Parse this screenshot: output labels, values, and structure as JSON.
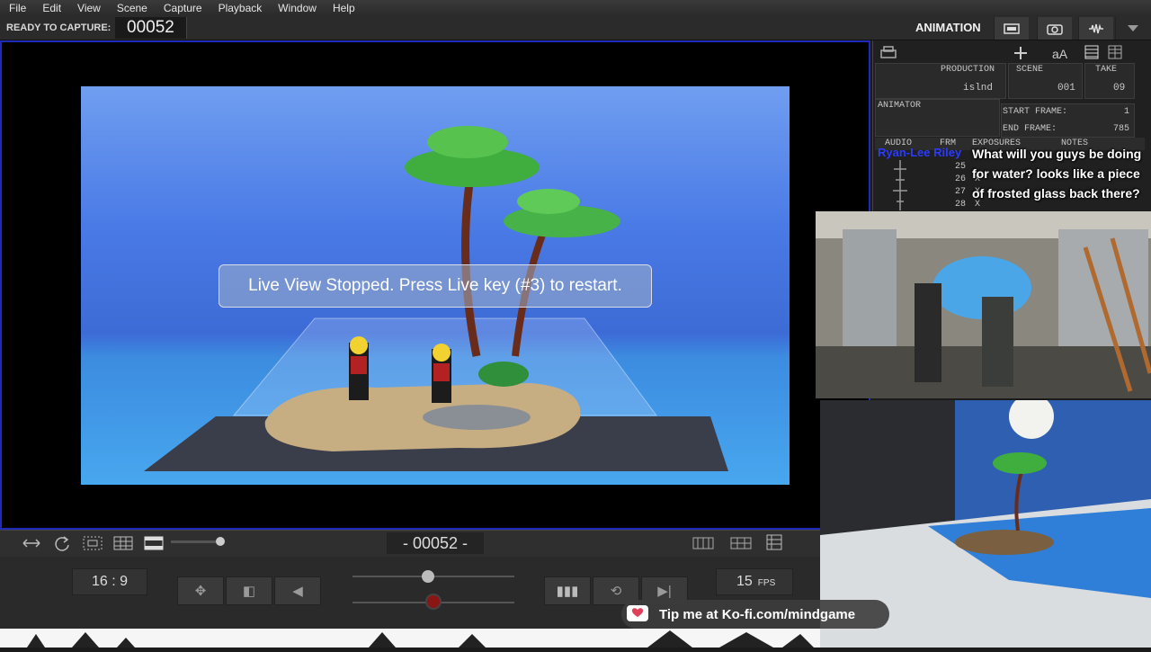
{
  "menu": [
    "File",
    "Edit",
    "View",
    "Scene",
    "Capture",
    "Playback",
    "Window",
    "Help"
  ],
  "capture": {
    "status": "READY TO CAPTURE:",
    "frame": "00052"
  },
  "mode": {
    "label": "ANIMATION"
  },
  "viewer": {
    "message": "Live View Stopped. Press Live key (#3) to restart."
  },
  "xsheet": {
    "headers": {
      "production": "PRODUCTION",
      "scene": "SCENE",
      "take": "TAKE"
    },
    "values": {
      "production": "islnd",
      "scene": "001",
      "take": "09"
    },
    "animator_label": "ANIMATOR",
    "start_frame_label": "START FRAME:",
    "start_frame": "1",
    "end_frame_label": "END FRAME:",
    "end_frame": "785",
    "columns": [
      "AUDIO",
      "FRM",
      "EXPOSURES",
      "NOTES"
    ],
    "rows": [
      {
        "frm": "25",
        "exp": ""
      },
      {
        "frm": "26",
        "exp": "X"
      },
      {
        "frm": "27",
        "exp": "X"
      },
      {
        "frm": "28",
        "exp": "X"
      }
    ]
  },
  "chat": {
    "user": "Ryan-Lee Riley",
    "message": "What will you guys be doing for water? looks like a piece of frosted glass back there?"
  },
  "playback": {
    "frame": "- 00052 -",
    "aspect": "16 : 9",
    "fps": "15",
    "fps_unit": "FPS"
  },
  "kofi": {
    "text": "Tip me at Ko-fi.com/mindgame"
  }
}
